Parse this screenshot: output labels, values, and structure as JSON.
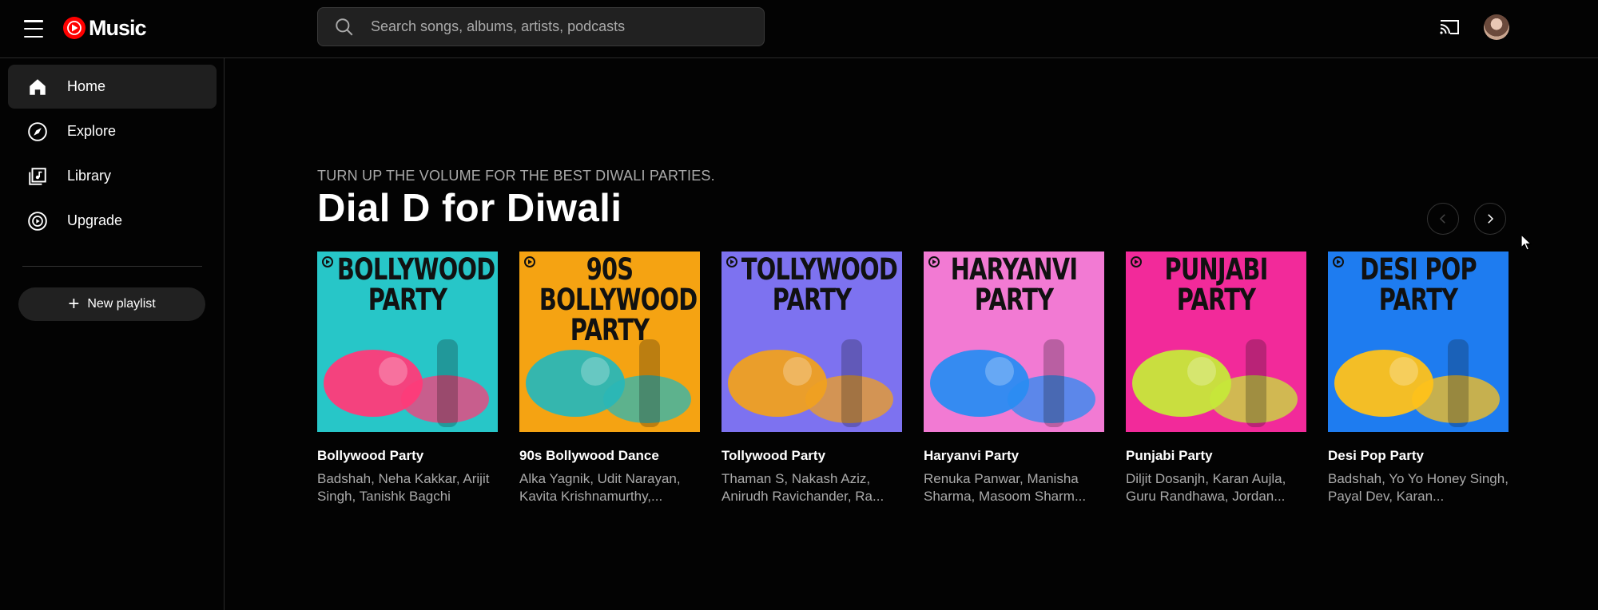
{
  "header": {
    "logo_text": "Music",
    "search_placeholder": "Search songs, albums, artists, podcasts"
  },
  "sidebar": {
    "items": [
      {
        "label": "Home",
        "icon": "home-icon",
        "active": true
      },
      {
        "label": "Explore",
        "icon": "compass-icon",
        "active": false
      },
      {
        "label": "Library",
        "icon": "library-icon",
        "active": false
      },
      {
        "label": "Upgrade",
        "icon": "upgrade-icon",
        "active": false
      }
    ],
    "new_playlist_label": "New playlist"
  },
  "shelf": {
    "strapline": "TURN UP THE VOLUME FOR THE BEST DIWALI PARTIES.",
    "title": "Dial D for Diwali",
    "cards": [
      {
        "art_text": "BOLLYWOOD\nPARTY",
        "title": "Bollywood Party",
        "subtitle": "Badshah, Neha Kakkar, Arijit Singh, Tanishk Bagchi",
        "bg": "#27c6c8",
        "accent": "#ff3b7a"
      },
      {
        "art_text": "90S\nBOLLYWOOD\nPARTY",
        "title": "90s Bollywood Dance",
        "subtitle": "Alka Yagnik, Udit Narayan, Kavita Krishnamurthy,...",
        "bg": "#f5a312",
        "accent": "#2ab7b7"
      },
      {
        "art_text": "TOLLYWOOD\nPARTY",
        "title": "Tollywood Party",
        "subtitle": "Thaman S, Nakash Aziz, Anirudh Ravichander, Ra...",
        "bg": "#7d72f0",
        "accent": "#f0a020"
      },
      {
        "art_text": "HARYANVI\nPARTY",
        "title": "Haryanvi Party",
        "subtitle": "Renuka Panwar, Manisha Sharma, Masoom Sharm...",
        "bg": "#f27ad3",
        "accent": "#2a8cf2"
      },
      {
        "art_text": "PUNJABI\nPARTY",
        "title": "Punjabi Party",
        "subtitle": "Diljit Dosanjh, Karan Aujla, Guru Randhawa, Jordan...",
        "bg": "#f22a9a",
        "accent": "#c6e83a"
      },
      {
        "art_text": "DESI POP\nPARTY",
        "title": "Desi Pop Party",
        "subtitle": "Badshah, Yo Yo Honey Singh, Payal Dev, Karan...",
        "bg": "#1e7cf0",
        "accent": "#ffc21a"
      }
    ]
  },
  "colors": {
    "background": "#030303",
    "brand_red": "#ff0000"
  }
}
